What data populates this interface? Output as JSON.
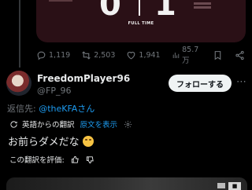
{
  "media_top": {
    "score_left": "0",
    "score_right": "1",
    "full_time_label": "FULL TIME"
  },
  "metrics": {
    "replies": "1,119",
    "retweets": "2,503",
    "likes": "1,941",
    "views": "85.7万"
  },
  "reply_tweet": {
    "display_name": "FreedomPlayer96",
    "handle": "@FP_96",
    "follow_label": "フォローする",
    "reply_prefix": "返信先: ",
    "reply_to": "@theKFAさん",
    "translated_from": "英語からの翻訳",
    "show_original": "原文を表示",
    "text": "お前らダメだな",
    "emoji": "rolling-on-floor-laughing",
    "rate_translation": "この翻訳を評価:"
  },
  "colors": {
    "background": "#000000",
    "accent": "#1d9bf0",
    "muted": "#71767b",
    "text": "#e7e9ea",
    "media_card": "#2a1016"
  }
}
